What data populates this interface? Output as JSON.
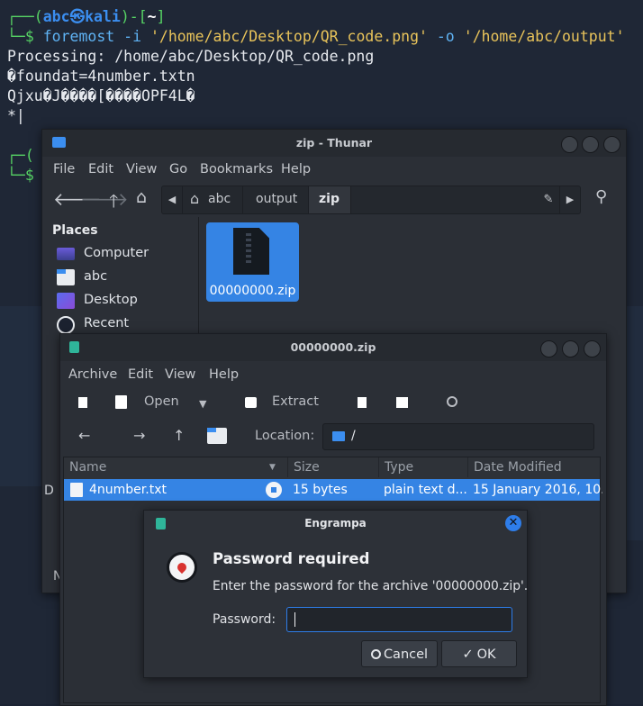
{
  "terminal": {
    "prompt_open": "┌──(",
    "user": "abc",
    "at_icon": "㉿",
    "host": "kali",
    "prompt_mid": ")-[",
    "cwd": "~",
    "prompt_close": "]",
    "prompt_sym": "└─$",
    "command_name": "foremost",
    "command_args": " -i ",
    "command_src": "'/home/abc/Desktop/QR_code.png'",
    "command_opt": " -o ",
    "command_dst": "'/home/abc/output'",
    "out1": "Processing: /home/abc/Desktop/QR_code.png",
    "out2": "�foundat=4number.txtn",
    "out3": "Qjxu�J����[����OPF4L�",
    "out4": "*|"
  },
  "thunar": {
    "title": "zip - Thunar",
    "menu": [
      "File",
      "Edit",
      "View",
      "Go",
      "Bookmarks",
      "Help"
    ],
    "breadcrumbs": [
      "abc",
      "output",
      "zip"
    ],
    "places_heading": "Places",
    "places": [
      {
        "label": "Computer",
        "icon": "computer-icon"
      },
      {
        "label": "abc",
        "icon": "home-folder-icon"
      },
      {
        "label": "Desktop",
        "icon": "desktop-icon"
      },
      {
        "label": "Recent",
        "icon": "recent-icon"
      }
    ],
    "file_name": "00000000.zip"
  },
  "engrampa": {
    "title": "00000000.zip",
    "menu": [
      "Archive",
      "Edit",
      "View",
      "Help"
    ],
    "toolbar": {
      "open": "Open",
      "extract": "Extract"
    },
    "location_label": "Location:",
    "location_value": "/",
    "columns": [
      "Name",
      "Size",
      "Type",
      "Date Modified"
    ],
    "rows": [
      {
        "name": "4number.txt",
        "size": "15 bytes",
        "type": "plain text d...",
        "date": "15 January 2016, 10..."
      }
    ]
  },
  "dialog": {
    "title": "Engrampa",
    "heading": "Password required",
    "message": "Enter the password for the archive '00000000.zip'.",
    "password_label": "Password:",
    "password_value": "",
    "cancel_label": "Cancel",
    "ok_label": "OK"
  },
  "colors": {
    "accent": "#2e7de9",
    "selection": "#3584e4",
    "terminal_bg": "#1f2736"
  }
}
